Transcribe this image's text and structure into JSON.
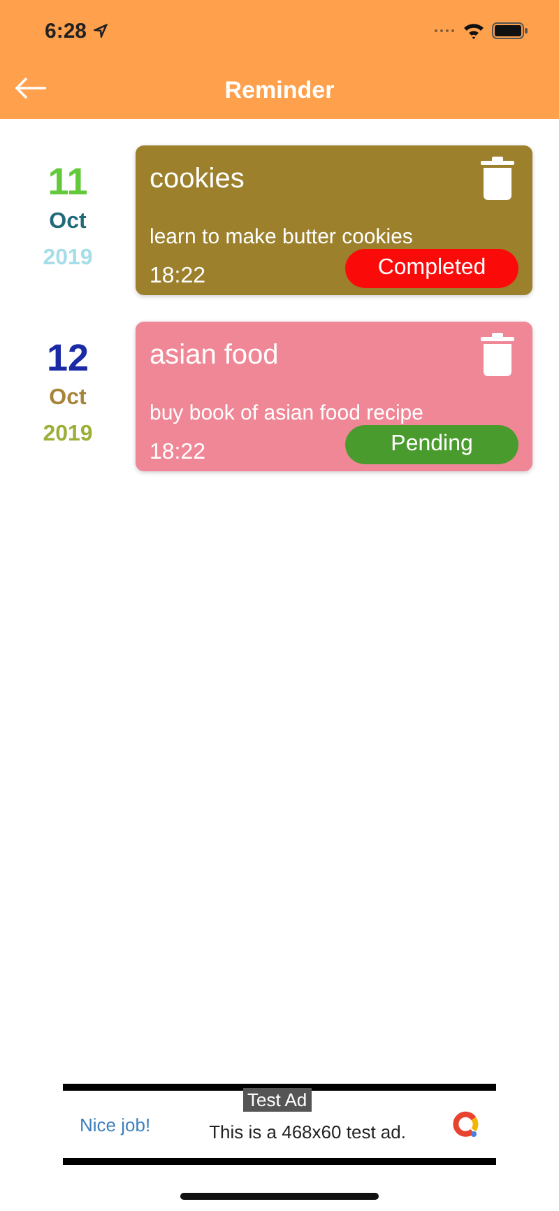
{
  "status_bar": {
    "time": "6:28"
  },
  "header": {
    "title": "Reminder"
  },
  "reminders": [
    {
      "day": {
        "text": "11",
        "color": "#62c93a"
      },
      "month": {
        "text": "Oct",
        "color": "#226a7a"
      },
      "year": {
        "text": "2019",
        "color": "#a5dde8"
      },
      "color": "#9c802c",
      "title": "cookies",
      "note": "learn to make butter cookies",
      "time": "18:22",
      "status": {
        "label": "Completed",
        "color": "#fb0a0a"
      }
    },
    {
      "day": {
        "text": "12",
        "color": "#1b2aa5"
      },
      "month": {
        "text": "Oct",
        "color": "#a7843a"
      },
      "year": {
        "text": "2019",
        "color": "#9ab036"
      },
      "color": "#ef8797",
      "title": "asian food",
      "note": "buy book of asian food recipe",
      "time": "18:22",
      "status": {
        "label": "Pending",
        "color": "#4a9b2e"
      }
    }
  ],
  "ad": {
    "label": "Test Ad",
    "headline": "Nice job!",
    "text": "This is a 468x60 test ad."
  }
}
